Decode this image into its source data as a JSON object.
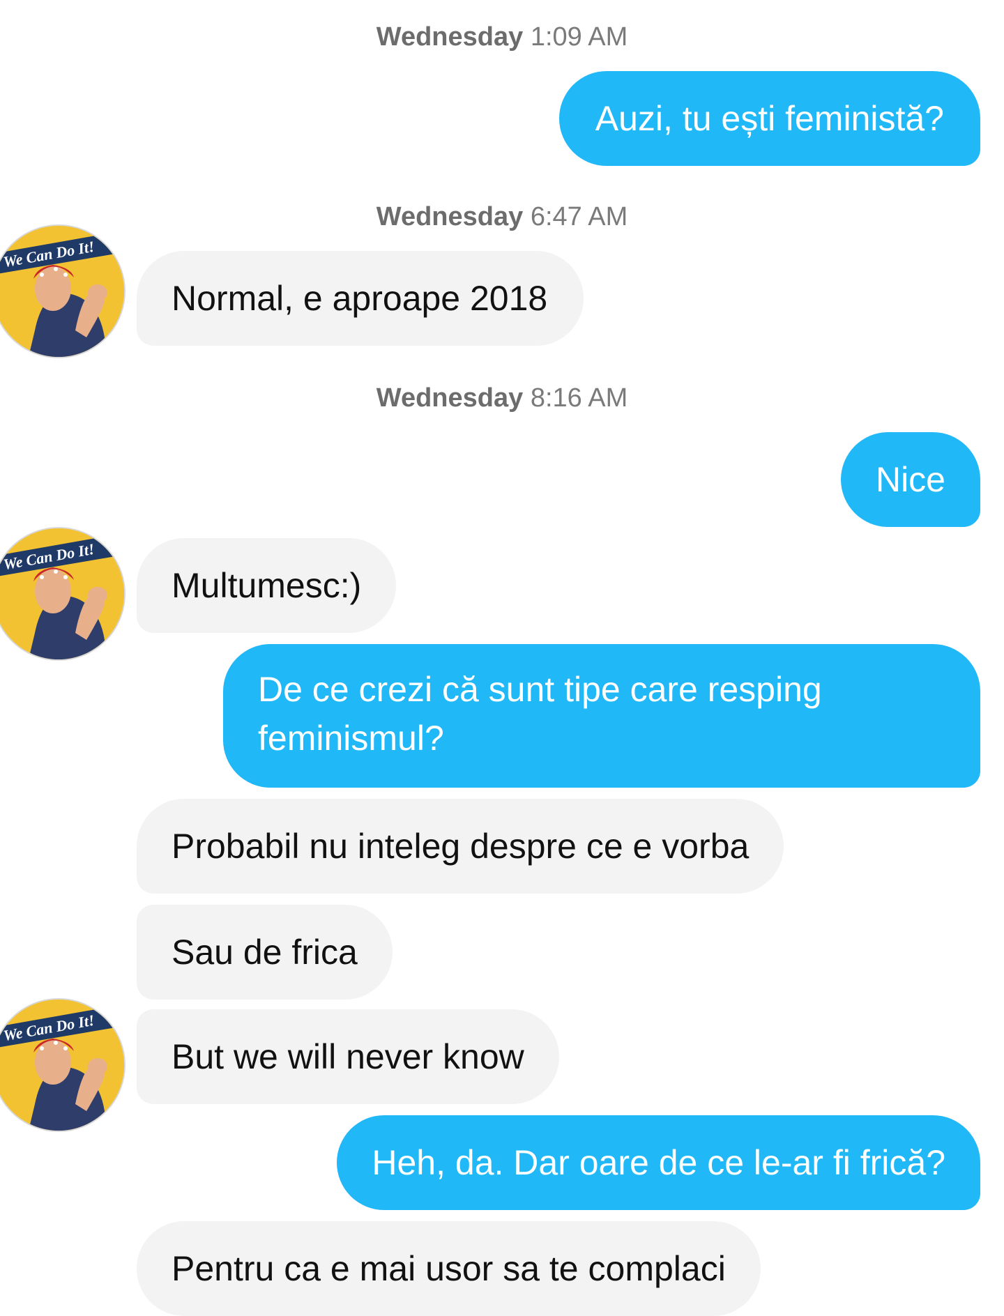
{
  "timestamps": [
    {
      "day": "Wednesday",
      "time": "1:09 AM"
    },
    {
      "day": "Wednesday",
      "time": "6:47 AM"
    },
    {
      "day": "Wednesday",
      "time": "8:16 AM"
    }
  ],
  "messages": [
    {
      "from": "me",
      "text": "Auzi, tu ești feministă?"
    },
    {
      "from": "them",
      "text": "Normal, e aproape 2018"
    },
    {
      "from": "me",
      "text": "Nice"
    },
    {
      "from": "them",
      "text": "Multumesc:)"
    },
    {
      "from": "me",
      "text": "De ce crezi că sunt tipe care resping feminismul?"
    },
    {
      "from": "them",
      "text": "Probabil nu inteleg despre ce e vorba"
    },
    {
      "from": "them",
      "text": "Sau de frica"
    },
    {
      "from": "them",
      "text": "But we will never know"
    },
    {
      "from": "me",
      "text": "Heh, da. Dar oare de ce le-ar fi frică?"
    },
    {
      "from": "them",
      "text": "Pentru ca e mai usor sa te complaci"
    }
  ],
  "avatar": {
    "caption": "We Can Do It!",
    "colors": {
      "background": "#f2c232",
      "banner": "#1f3a66",
      "shirt": "#2f3d6b",
      "skin": "#e8b08a",
      "bandana": "#c8262c"
    }
  },
  "colors": {
    "outgoing_bubble": "#21b8f8",
    "incoming_bubble": "#f3f3f3",
    "timestamp_text": "#7a7a7a"
  }
}
